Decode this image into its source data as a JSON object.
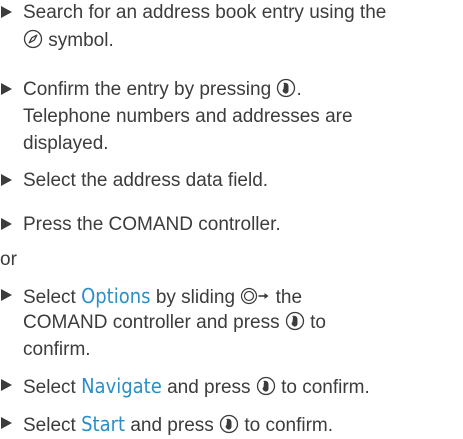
{
  "steps": [
    {
      "lines": [
        "Search for an address book entry using the",
        "symbol."
      ]
    },
    {
      "lines": [
        "Confirm the entry by pressing",
        ".",
        "Telephone numbers and addresses are",
        "displayed."
      ]
    },
    {
      "lines": [
        "Select the address data field."
      ]
    },
    {
      "lines": [
        "Press the COMAND controller."
      ]
    },
    {
      "or_text": "or"
    },
    {
      "prefix": "Select",
      "keyword": "Options",
      "middle": "by sliding",
      "suffix": "the",
      "line2": "COMAND controller and press",
      "line2_suffix": "to",
      "line3": "confirm."
    },
    {
      "prefix": "Select",
      "keyword": "Navigate",
      "suffix": "and press",
      "end": "to confirm."
    },
    {
      "prefix": "Select",
      "keyword": "Start",
      "suffix": "and press",
      "end": "to confirm."
    }
  ],
  "icons": {
    "navigation": "compass-icon",
    "press": "press-controller-icon",
    "slide": "slide-right-icon"
  },
  "colors": {
    "text": "#3c3c3c",
    "keyword": "#2a8fc8"
  }
}
